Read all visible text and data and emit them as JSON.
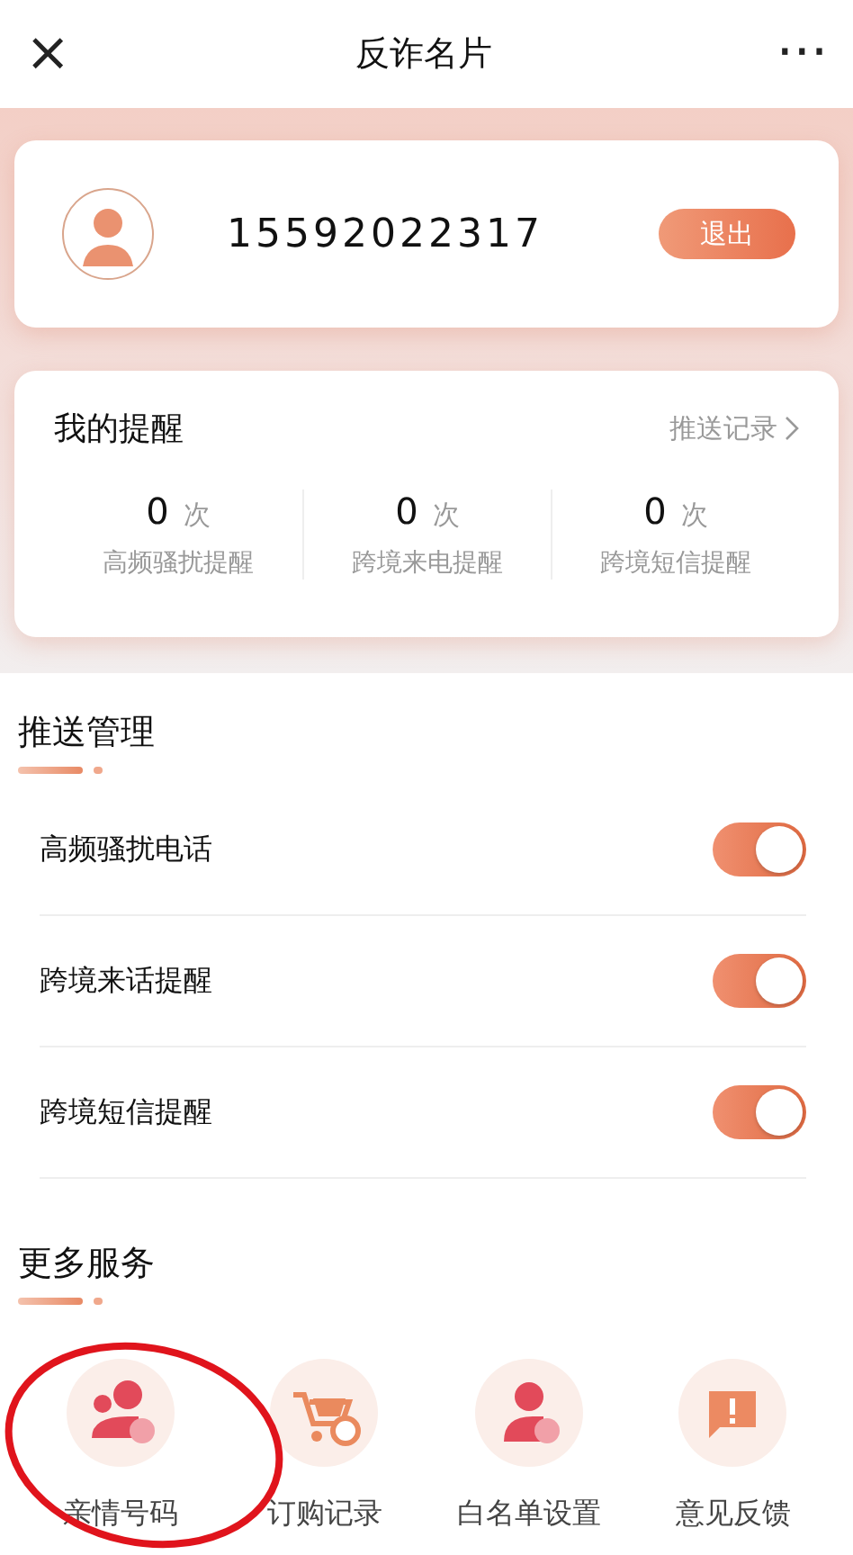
{
  "header": {
    "close": "×",
    "title": "反诈名片",
    "more": "···"
  },
  "profile": {
    "phone": "15592022317",
    "logout": "退出"
  },
  "reminders": {
    "title": "我的提醒",
    "link": "推送记录",
    "stats": [
      {
        "count": "0",
        "unit": "次",
        "label": "高频骚扰提醒"
      },
      {
        "count": "0",
        "unit": "次",
        "label": "跨境来电提醒"
      },
      {
        "count": "0",
        "unit": "次",
        "label": "跨境短信提醒"
      }
    ]
  },
  "push": {
    "title": "推送管理",
    "items": [
      {
        "label": "高频骚扰电话",
        "on": true
      },
      {
        "label": "跨境来话提醒",
        "on": true
      },
      {
        "label": "跨境短信提醒",
        "on": true
      }
    ]
  },
  "services": {
    "title": "更多服务",
    "items": [
      {
        "label": "亲情号码",
        "kind": "family",
        "circled": true
      },
      {
        "label": "订购记录",
        "kind": "orders",
        "circled": false
      },
      {
        "label": "白名单设置",
        "kind": "whitelist",
        "circled": false
      },
      {
        "label": "意见反馈",
        "kind": "feedback",
        "circled": false
      }
    ]
  }
}
